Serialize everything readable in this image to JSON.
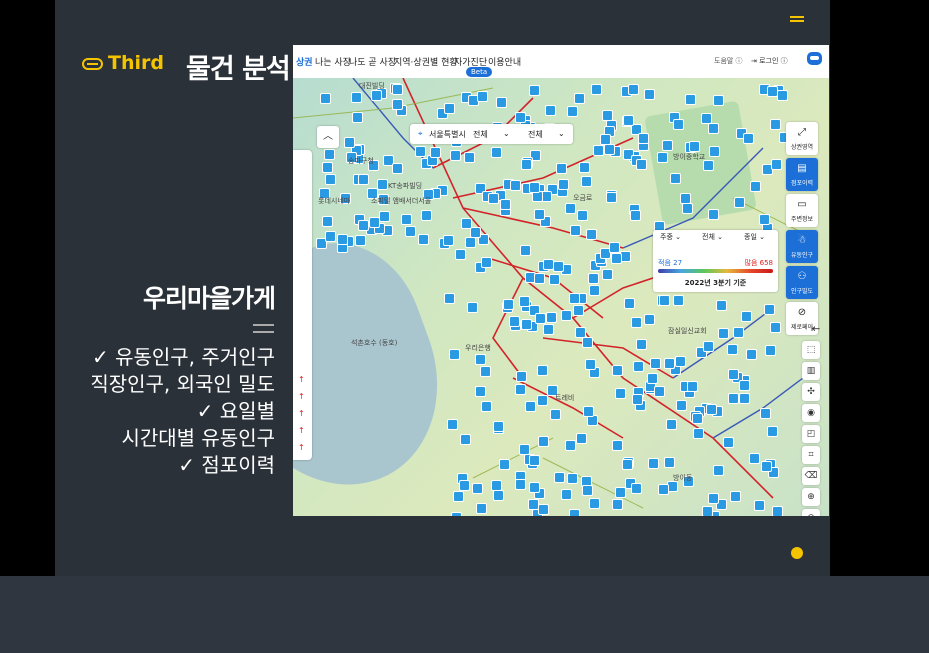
{
  "slide": {
    "section": "Third",
    "title": "물건 분석",
    "subtitle": "우리마을가게",
    "bullets": [
      "✓ 유동인구, 주거인구",
      "직장인구, 외국인 밀도",
      "✓ 요일별",
      "시간대별 유동인구",
      "✓ 점포이력"
    ]
  },
  "app": {
    "nav": {
      "active": "상권",
      "items": [
        "나는 사장",
        "나도 곧 사장",
        "지역·상권별 현황",
        "자가진단",
        "이용안내"
      ],
      "beta": "Beta"
    },
    "help": "도움말",
    "login": "로그인"
  },
  "map": {
    "region": {
      "city": "서울특별시",
      "district": "전체",
      "dong": "전체"
    },
    "labels": [
      "송파구청",
      "KT송파빌딩",
      "소피텔 앰배서더서울",
      "롯데시네마",
      "석촌호수 (동호)",
      "트레비",
      "방이중학교",
      "잠실일신교회",
      "오금로",
      "우리은행",
      "대진빌딩",
      "방이동"
    ],
    "legend": {
      "filters": [
        "주중",
        "전체",
        "종일"
      ],
      "low_label": "적음",
      "low_value": "27",
      "high_label": "많음",
      "high_value": "658",
      "date": "2022년 3분기 기준"
    },
    "tools": [
      {
        "label": "상권영역",
        "icon": "expand-icon",
        "active": false
      },
      {
        "label": "점포이력",
        "icon": "store-history-icon",
        "active": true
      },
      {
        "label": "주변정보",
        "icon": "chat-icon",
        "active": false
      },
      {
        "label": "유동인구",
        "icon": "walker-icon",
        "active": true
      },
      {
        "label": "인구밀도",
        "icon": "people-icon",
        "active": true
      },
      {
        "label": "제로페이",
        "icon": "zeropay-icon",
        "active": false
      }
    ]
  },
  "colors": {
    "accent": "#f5c400",
    "slide_bg": "#2b3138",
    "brand_blue": "#1b6fd6"
  }
}
